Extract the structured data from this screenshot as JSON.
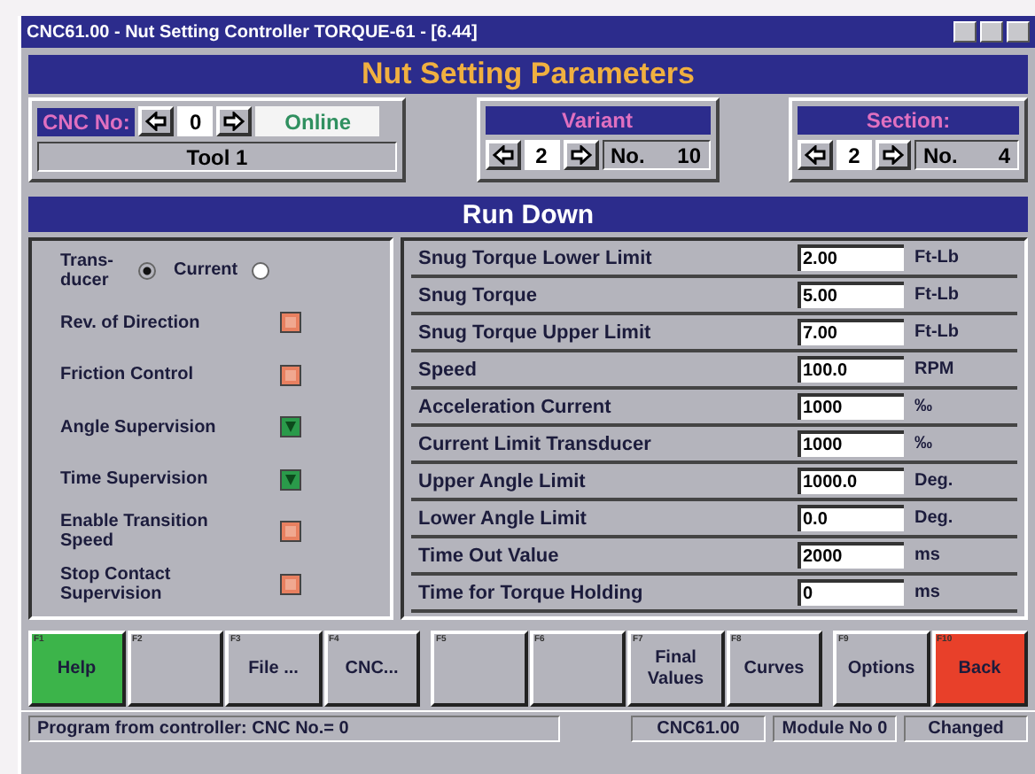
{
  "window": {
    "title": "CNC61.00 - Nut Setting Controller TORQUE-61 - [6.44]"
  },
  "header": "Nut Setting Parameters",
  "cnc": {
    "label": "CNC No:",
    "value": "0",
    "status": "Online",
    "tool": "Tool 1"
  },
  "variant": {
    "title": "Variant",
    "value": "2",
    "no_label": "No.",
    "no": "10"
  },
  "section": {
    "title": "Section:",
    "value": "2",
    "no_label": "No.",
    "no": "4"
  },
  "run_down": {
    "title": "Run Down",
    "transducer": [
      {
        "label": "Trans-ducer",
        "selected": true
      },
      {
        "label": "Current",
        "selected": false
      }
    ],
    "options": [
      {
        "label": "Rev. of Direction",
        "checked": false
      },
      {
        "label": "Friction Control",
        "checked": false
      },
      {
        "label": "Angle Supervision",
        "checked": true
      },
      {
        "label": "Time Supervision",
        "checked": true
      },
      {
        "label": "Enable Transition Speed",
        "checked": false
      },
      {
        "label": "Stop Contact Supervision",
        "checked": false
      }
    ],
    "params": [
      {
        "label": "Snug Torque Lower Limit",
        "value": "2.00",
        "unit": "Ft-Lb"
      },
      {
        "label": "Snug Torque",
        "value": "5.00",
        "unit": "Ft-Lb"
      },
      {
        "label": "Snug Torque Upper Limit",
        "value": "7.00",
        "unit": "Ft-Lb"
      },
      {
        "label": "Speed",
        "value": "100.0",
        "unit": "RPM"
      },
      {
        "label": "Acceleration Current",
        "value": "1000",
        "unit": "‰"
      },
      {
        "label": "Current Limit Transducer",
        "value": "1000",
        "unit": "‰"
      },
      {
        "label": "Upper Angle Limit",
        "value": "1000.0",
        "unit": "Deg."
      },
      {
        "label": "Lower Angle Limit",
        "value": "0.0",
        "unit": "Deg."
      },
      {
        "label": "Time Out Value",
        "value": "2000",
        "unit": "ms"
      },
      {
        "label": "Time for Torque Holding",
        "value": "0",
        "unit": "ms"
      }
    ]
  },
  "function_keys": [
    {
      "key": "F1",
      "label": "Help",
      "color": "#3cb44a"
    },
    {
      "key": "F2",
      "color": "#b4b4bc"
    },
    {
      "key": "F3",
      "label": "File ...",
      "color": "#b4b4bc"
    },
    {
      "key": "F4",
      "label": "CNC...",
      "color": "#b4b4bc"
    },
    {
      "key": "F5",
      "color": "#b4b4bc"
    },
    {
      "key": "F6",
      "color": "#b4b4bc"
    },
    {
      "key": "F7",
      "label": "Final Values",
      "color": "#b4b4bc"
    },
    {
      "key": "F8",
      "label": "Curves",
      "color": "#b4b4bc"
    },
    {
      "key": "F9",
      "label": "Options",
      "color": "#b4b4bc"
    },
    {
      "key": "F10",
      "label": "Back",
      "color": "#e8402a"
    }
  ],
  "status_bar": {
    "message": "Program from controller: CNC No.= 0",
    "items": [
      "CNC61.00",
      "Module No 0",
      "Changed"
    ]
  }
}
